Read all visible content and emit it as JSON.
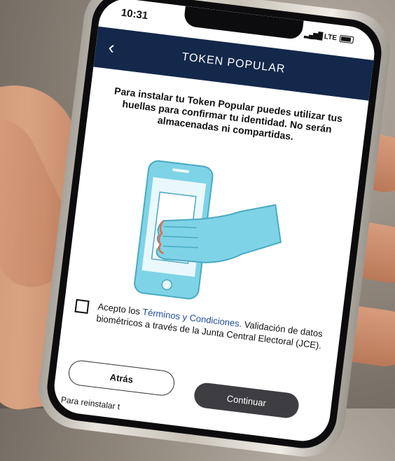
{
  "status_bar": {
    "time": "10:31",
    "network": "LTE"
  },
  "app_bar": {
    "back_glyph": "‹",
    "title": "TOKEN POPULAR"
  },
  "intro_text": "Para instalar tu Token Popular puedes utilizar tus huellas para confirmar tu identidad. No serán almacenadas ni compartidas.",
  "consent": {
    "checked": false,
    "prefix": "Acepto los ",
    "link": "Términos y Condiciones.",
    "detail": "Validación de datos biométricos a través de la Junta Central Electoral (JCE)."
  },
  "buttons": {
    "back": "Atrás",
    "continue": "Continuar"
  },
  "footer_text": "Para reinstalar t",
  "colors": {
    "app_bar": "#13284a",
    "link": "#1f4d9a",
    "illustration": "#7fd3e6",
    "continue_button": "#3e3e42"
  }
}
